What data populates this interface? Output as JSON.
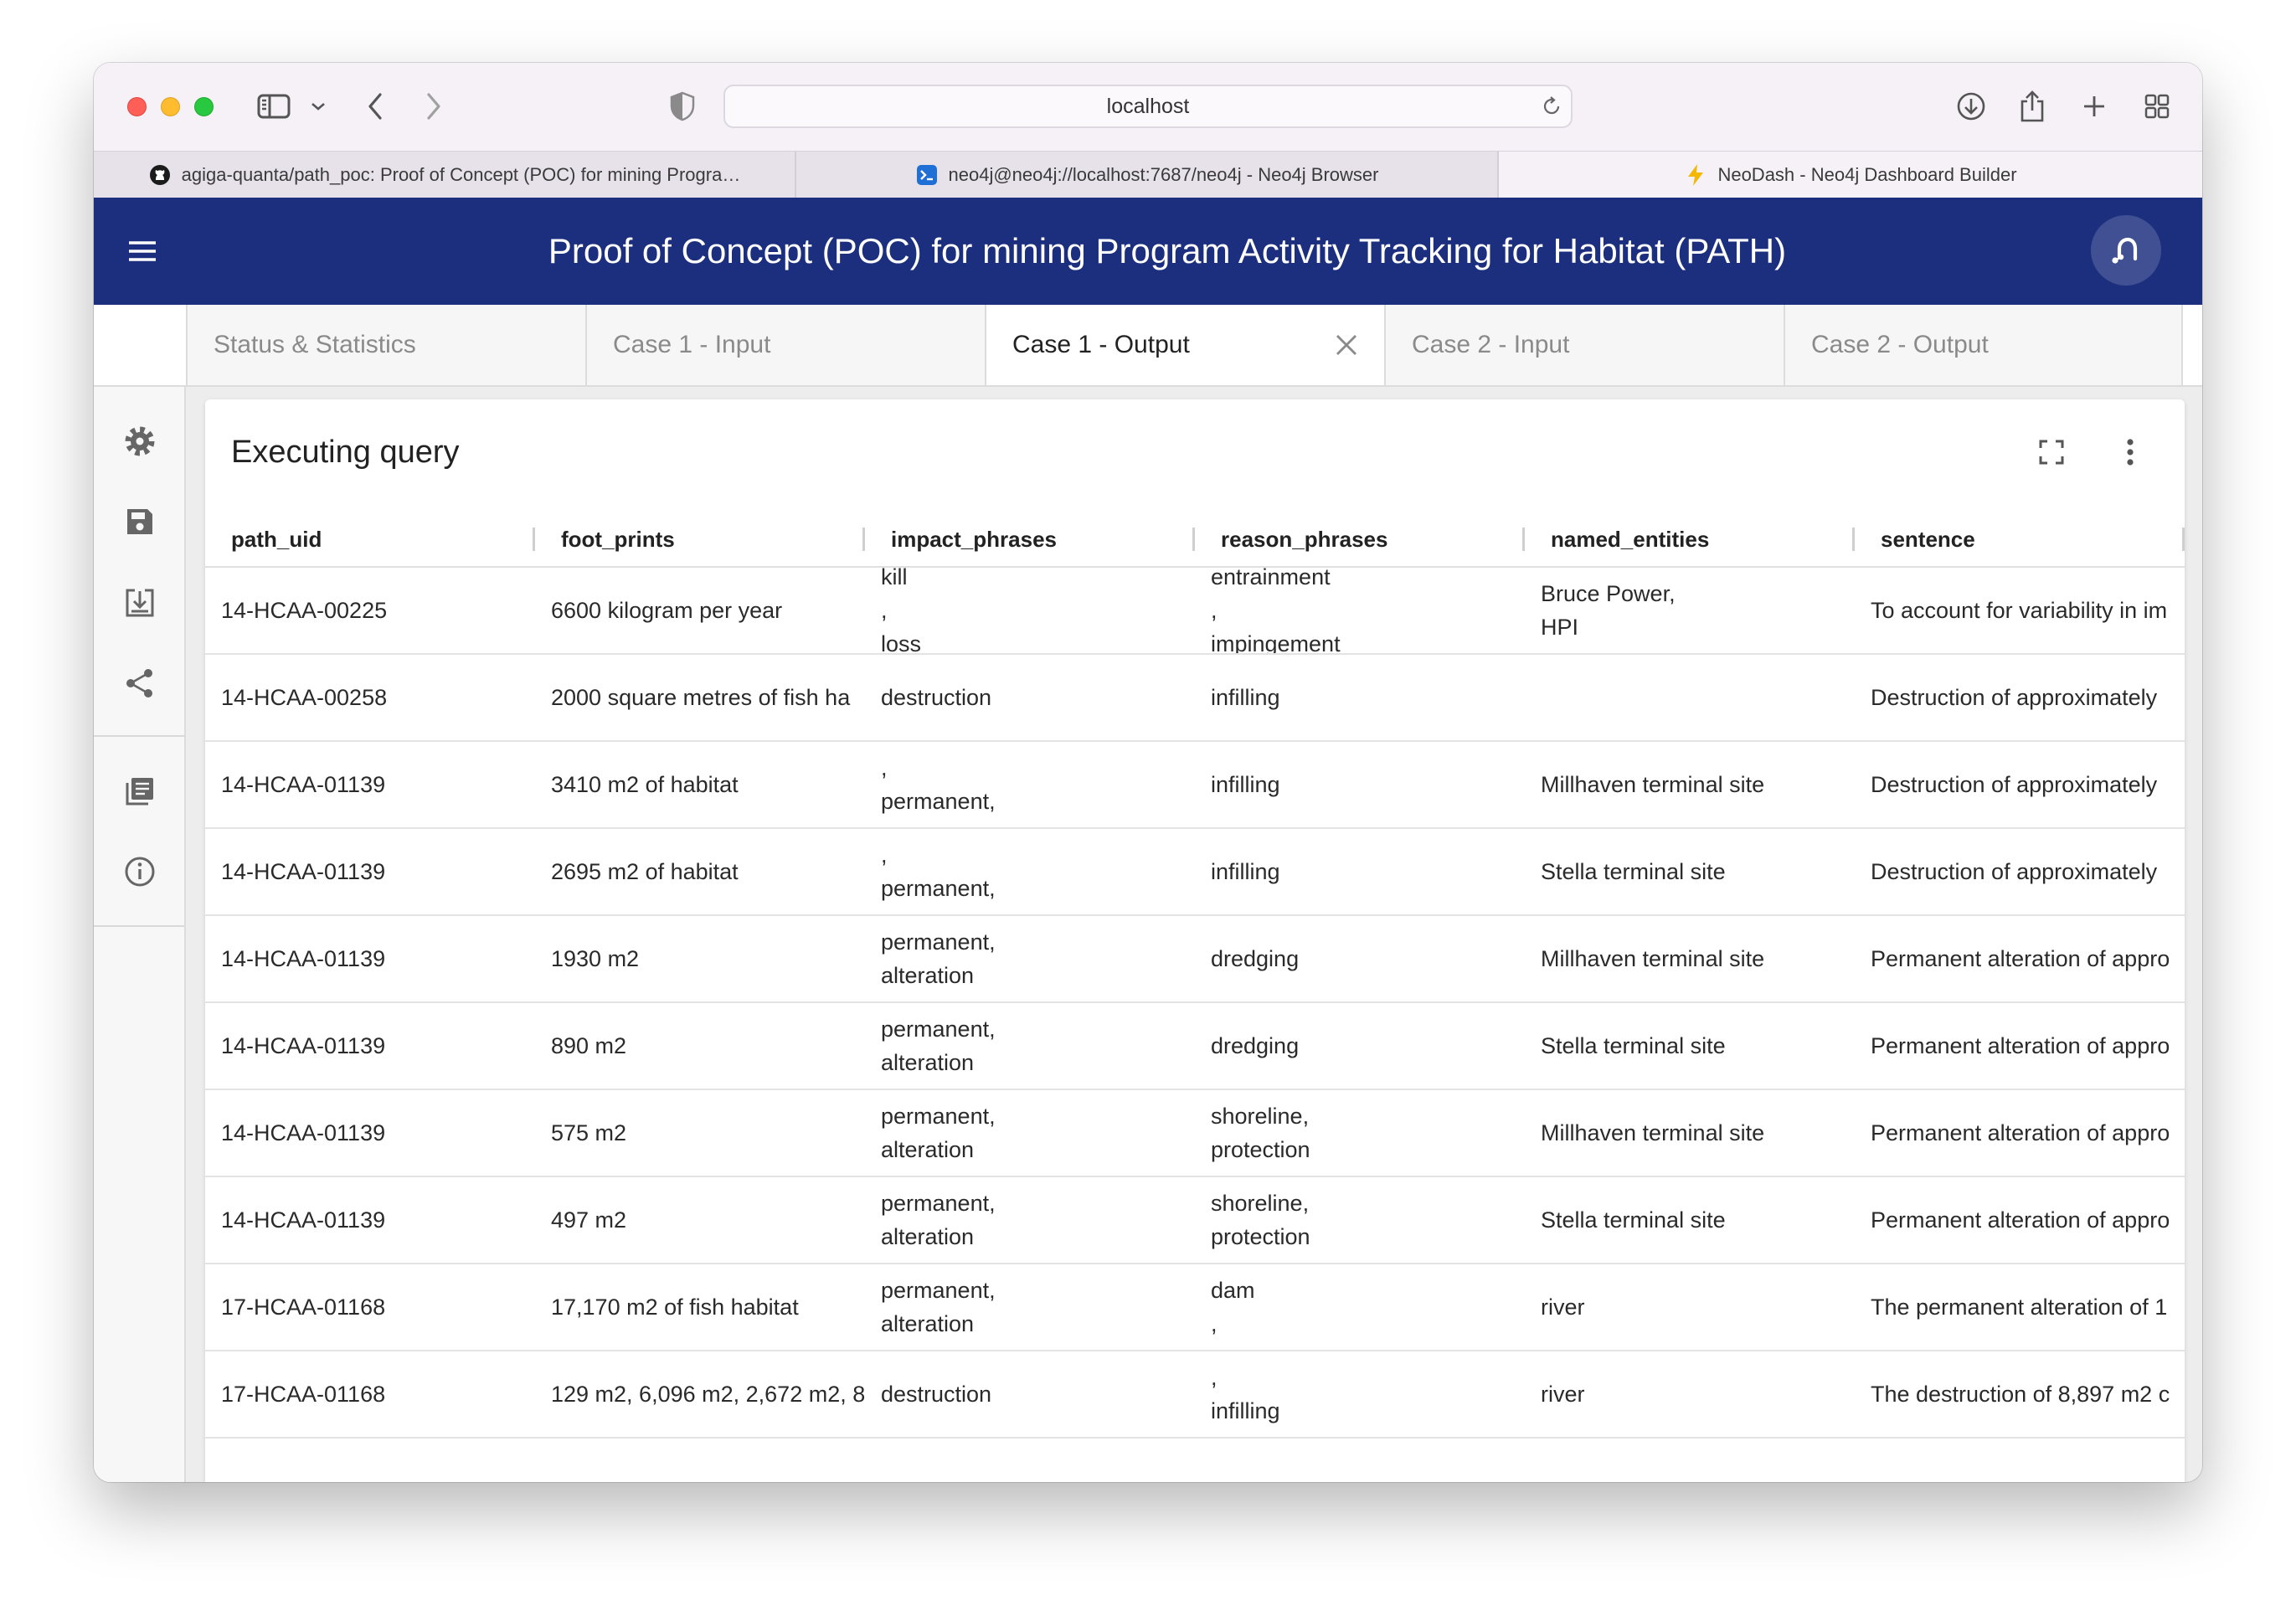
{
  "browser": {
    "address": "localhost",
    "tabs": [
      {
        "label": "agiga-quanta/path_poc: Proof of Concept (POC) for mining Progra…",
        "icon": "github-icon"
      },
      {
        "label": "neo4j@neo4j://localhost:7687/neo4j - Neo4j Browser",
        "icon": "terminal-icon"
      },
      {
        "label": "NeoDash - Neo4j Dashboard Builder",
        "icon": "lightning-icon",
        "active": true
      }
    ]
  },
  "header": {
    "title": "Proof of Concept (POC) for mining Program Activity Tracking for Habitat (PATH)",
    "background": "#1c2f7e"
  },
  "dashboard_tabs": [
    {
      "label": "Status & Statistics"
    },
    {
      "label": "Case 1 - Input"
    },
    {
      "label": "Case 1 - Output",
      "active": true
    },
    {
      "label": "Case 2 - Input"
    },
    {
      "label": "Case 2 - Output"
    }
  ],
  "sidebar": {
    "icons": [
      "gear-icon",
      "save-icon",
      "download-icon",
      "share-icon",
      "library-icon",
      "info-icon"
    ]
  },
  "card": {
    "title": "Executing query"
  },
  "table": {
    "columns": [
      "path_uid",
      "foot_prints",
      "impact_phrases",
      "reason_phrases",
      "named_entities",
      "sentence"
    ],
    "rows": [
      {
        "path_uid": "14-HCAA-00225",
        "foot_prints": "6600 kilogram per year",
        "impact_phrases": [
          "kill",
          ",",
          "loss"
        ],
        "reason_phrases": [
          "entrainment",
          ",",
          "impingement"
        ],
        "named_entities": [
          "Bruce Power,",
          "HPI"
        ],
        "sentence": "To account for variability in im"
      },
      {
        "path_uid": "14-HCAA-00258",
        "foot_prints": "2000 square metres of fish ha",
        "impact_phrases": [
          "destruction"
        ],
        "reason_phrases": [
          "infilling"
        ],
        "named_entities": [],
        "sentence": "Destruction of approximately"
      },
      {
        "path_uid": "14-HCAA-01139",
        "foot_prints": "3410 m2 of habitat",
        "impact_phrases": [
          ",",
          "permanent,"
        ],
        "reason_phrases": [
          "infilling"
        ],
        "named_entities": [
          "Millhaven terminal site"
        ],
        "sentence": "Destruction of approximately"
      },
      {
        "path_uid": "14-HCAA-01139",
        "foot_prints": "2695 m2 of habitat",
        "impact_phrases": [
          ",",
          "permanent,"
        ],
        "reason_phrases": [
          "infilling"
        ],
        "named_entities": [
          "Stella terminal site"
        ],
        "sentence": "Destruction of approximately"
      },
      {
        "path_uid": "14-HCAA-01139",
        "foot_prints": "1930 m2",
        "impact_phrases": [
          "permanent,",
          "alteration"
        ],
        "reason_phrases": [
          "dredging"
        ],
        "named_entities": [
          "Millhaven terminal site"
        ],
        "sentence": "Permanent alteration of appro"
      },
      {
        "path_uid": "14-HCAA-01139",
        "foot_prints": "890 m2",
        "impact_phrases": [
          "permanent,",
          "alteration"
        ],
        "reason_phrases": [
          "dredging"
        ],
        "named_entities": [
          "Stella terminal site"
        ],
        "sentence": "Permanent alteration of appro"
      },
      {
        "path_uid": "14-HCAA-01139",
        "foot_prints": "575 m2",
        "impact_phrases": [
          "permanent,",
          "alteration"
        ],
        "reason_phrases": [
          "shoreline,",
          "protection"
        ],
        "named_entities": [
          "Millhaven terminal site"
        ],
        "sentence": "Permanent alteration of appro"
      },
      {
        "path_uid": "14-HCAA-01139",
        "foot_prints": "497 m2",
        "impact_phrases": [
          "permanent,",
          "alteration"
        ],
        "reason_phrases": [
          "shoreline,",
          "protection"
        ],
        "named_entities": [
          "Stella terminal site"
        ],
        "sentence": "Permanent alteration of appro"
      },
      {
        "path_uid": "17-HCAA-01168",
        "foot_prints": "17,170 m2 of fish habitat",
        "impact_phrases": [
          "permanent,",
          "alteration"
        ],
        "reason_phrases": [
          "dam",
          ","
        ],
        "named_entities": [
          "river"
        ],
        "sentence": "The permanent alteration of 1"
      },
      {
        "path_uid": "17-HCAA-01168",
        "foot_prints": "129 m2, 6,096 m2, 2,672 m2, 8",
        "impact_phrases": [
          "destruction"
        ],
        "reason_phrases": [
          ",",
          "infilling"
        ],
        "named_entities": [
          "river"
        ],
        "sentence": "The destruction of 8,897 m2 c"
      }
    ]
  }
}
